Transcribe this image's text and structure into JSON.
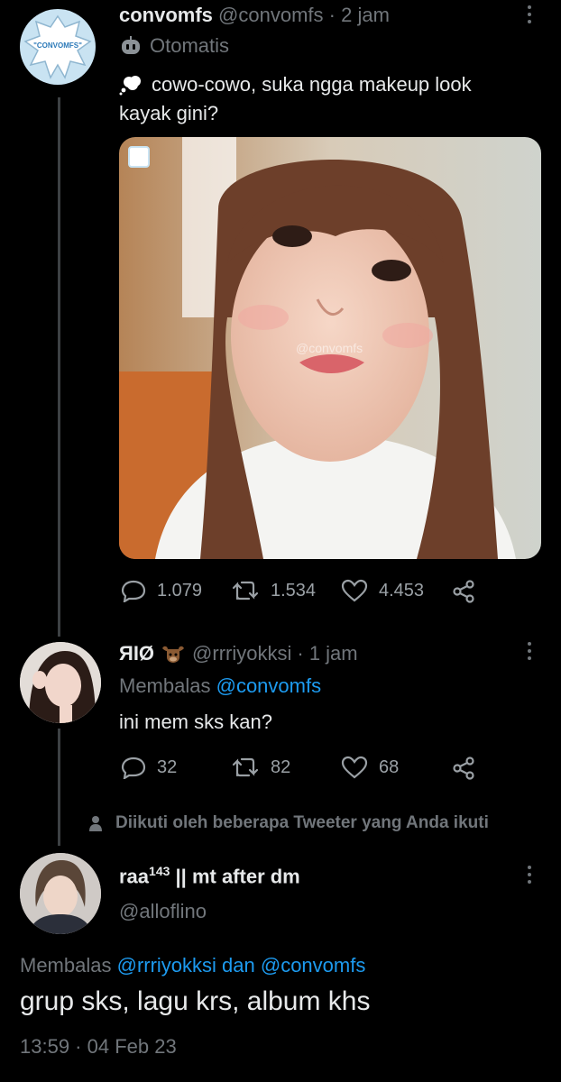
{
  "tweet1": {
    "display_name": "convomfs",
    "handle": "@convomfs",
    "time": "· 2 jam",
    "automated_label": "Otomatis",
    "text_line1": "cowo-cowo, suka ngga makeup look",
    "text_line2": "kayak gini?",
    "avatar_text": "\"CONVOMFS\"",
    "watermark": "@convomfs",
    "stats": {
      "replies": "1.079",
      "retweets": "1.534",
      "likes": "4.453"
    }
  },
  "reply1": {
    "display_name": "ЯIØ",
    "handle": "@rrriyokksi",
    "time": "· 1 jam",
    "replying_to_label": "Membalas",
    "replying_to_handle": "@convomfs",
    "text": "ini mem sks kan?",
    "stats": {
      "replies": "32",
      "retweets": "82",
      "likes": "68"
    }
  },
  "followed_notice": "Diikuti oleh beberapa Tweeter yang Anda ikuti",
  "reply2": {
    "display_name": "raa",
    "name_superscript": "143",
    "name_suffix": " || mt after dm",
    "handle": "@alloflino",
    "replying_to_label": "Membalas",
    "replying_to_handles": "@rrriyokksi dan @convomfs",
    "text": "grup sks, lagu krs, album khs",
    "timestamp": "13:59 · 04 Feb 23"
  },
  "colors": {
    "background": "#000000",
    "text": "#e7e9ea",
    "muted": "#71767b",
    "link": "#1d9bf0",
    "thread_line": "#3d4144"
  }
}
